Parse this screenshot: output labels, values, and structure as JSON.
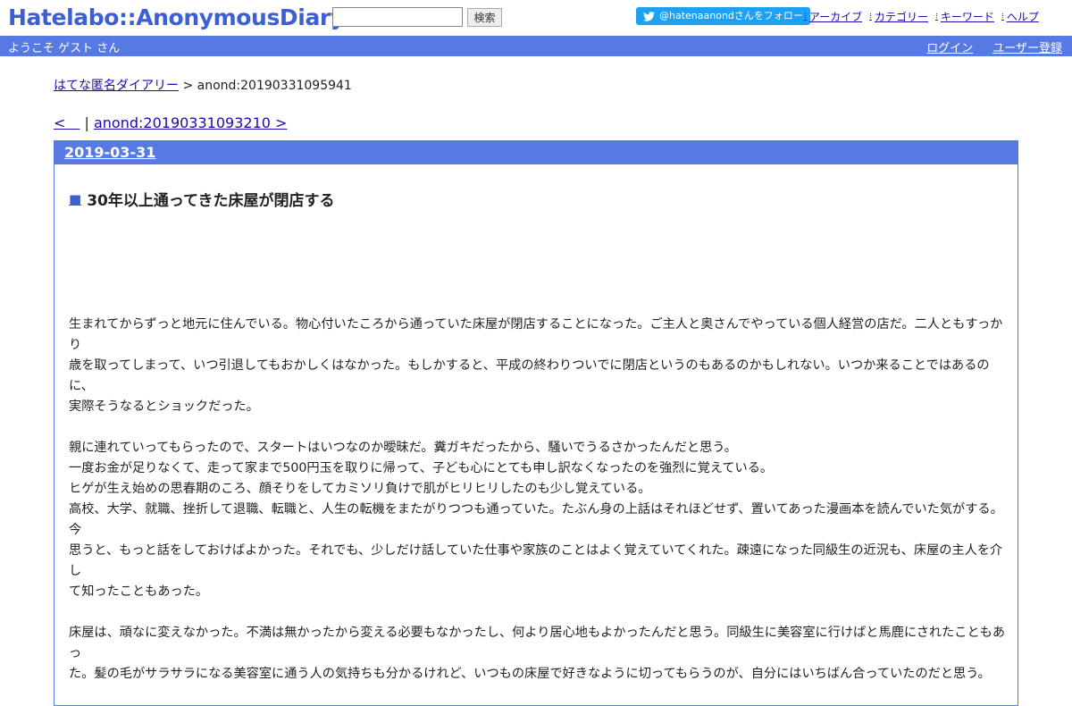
{
  "header": {
    "logo": "Hatelabo::AnonymousDiary",
    "search_button": "検索",
    "follow_button": "@hatenaanondさんをフォロー",
    "links": [
      "アーカイブ",
      "カテゴリー",
      "キーワード",
      "ヘルプ"
    ]
  },
  "bar": {
    "welcome": "ようこそ ゲスト さん",
    "login": "ログイン",
    "register": "ユーザー登録"
  },
  "breadcrumb": {
    "root": "はてな匿名ダイアリー",
    "separator": " > ",
    "current": "anond:20190331095941"
  },
  "pager": {
    "prev": "<　",
    "sep": " | ",
    "next": "anond:20190331093210 >"
  },
  "day": {
    "date": "2019-03-31",
    "title_mark": "■",
    "title": "30年以上通ってきた床屋が閉店する",
    "paragraphs": [
      [
        "生まれてからずっと地元に住んでいる。物心付いたころから通っていた床屋が閉店することになった。ご主人と奥さんでやっている個人経営の店だ。二人ともすっかり",
        "歳を取ってしまって、いつ引退してもおかしくはなかった。もしかすると、平成の終わりついでに閉店というのもあるのかもしれない。いつか来ることではあるのに、",
        "実際そうなるとショックだった。"
      ],
      [
        "親に連れていってもらったので、スタートはいつなのか曖昧だ。糞ガキだったから、騒いでうるさかったんだと思う。",
        "一度お金が足りなくて、走って家まで500円玉を取りに帰って、子ども心にとても申し訳なくなったのを強烈に覚えている。",
        "ヒゲが生え始めの思春期のころ、顔そりをしてカミソリ負けで肌がヒリヒリしたのも少し覚えている。",
        "高校、大学、就職、挫折して退職、転職と、人生の転機をまたがりつつも通っていた。たぶん身の上話はそれほどせず、置いてあった漫画本を読んでいた気がする。今",
        "思うと、もっと話をしておけばよかった。それでも、少しだけ話していた仕事や家族のことはよく覚えていてくれた。疎遠になった同級生の近況も、床屋の主人を介し",
        "て知ったこともあった。"
      ],
      [
        "床屋は、頑なに変えなかった。不満は無かったから変える必要もなかったし、何より居心地もよかったんだと思う。同級生に美容室に行けばと馬鹿にされたこともあっ",
        "た。髪の毛がサラサラになる美容室に通う人の気持ちも分かるけれど、いつもの床屋で好きなように切ってもらうのが、自分にはいちばん合っていたのだと思う。"
      ]
    ]
  }
}
